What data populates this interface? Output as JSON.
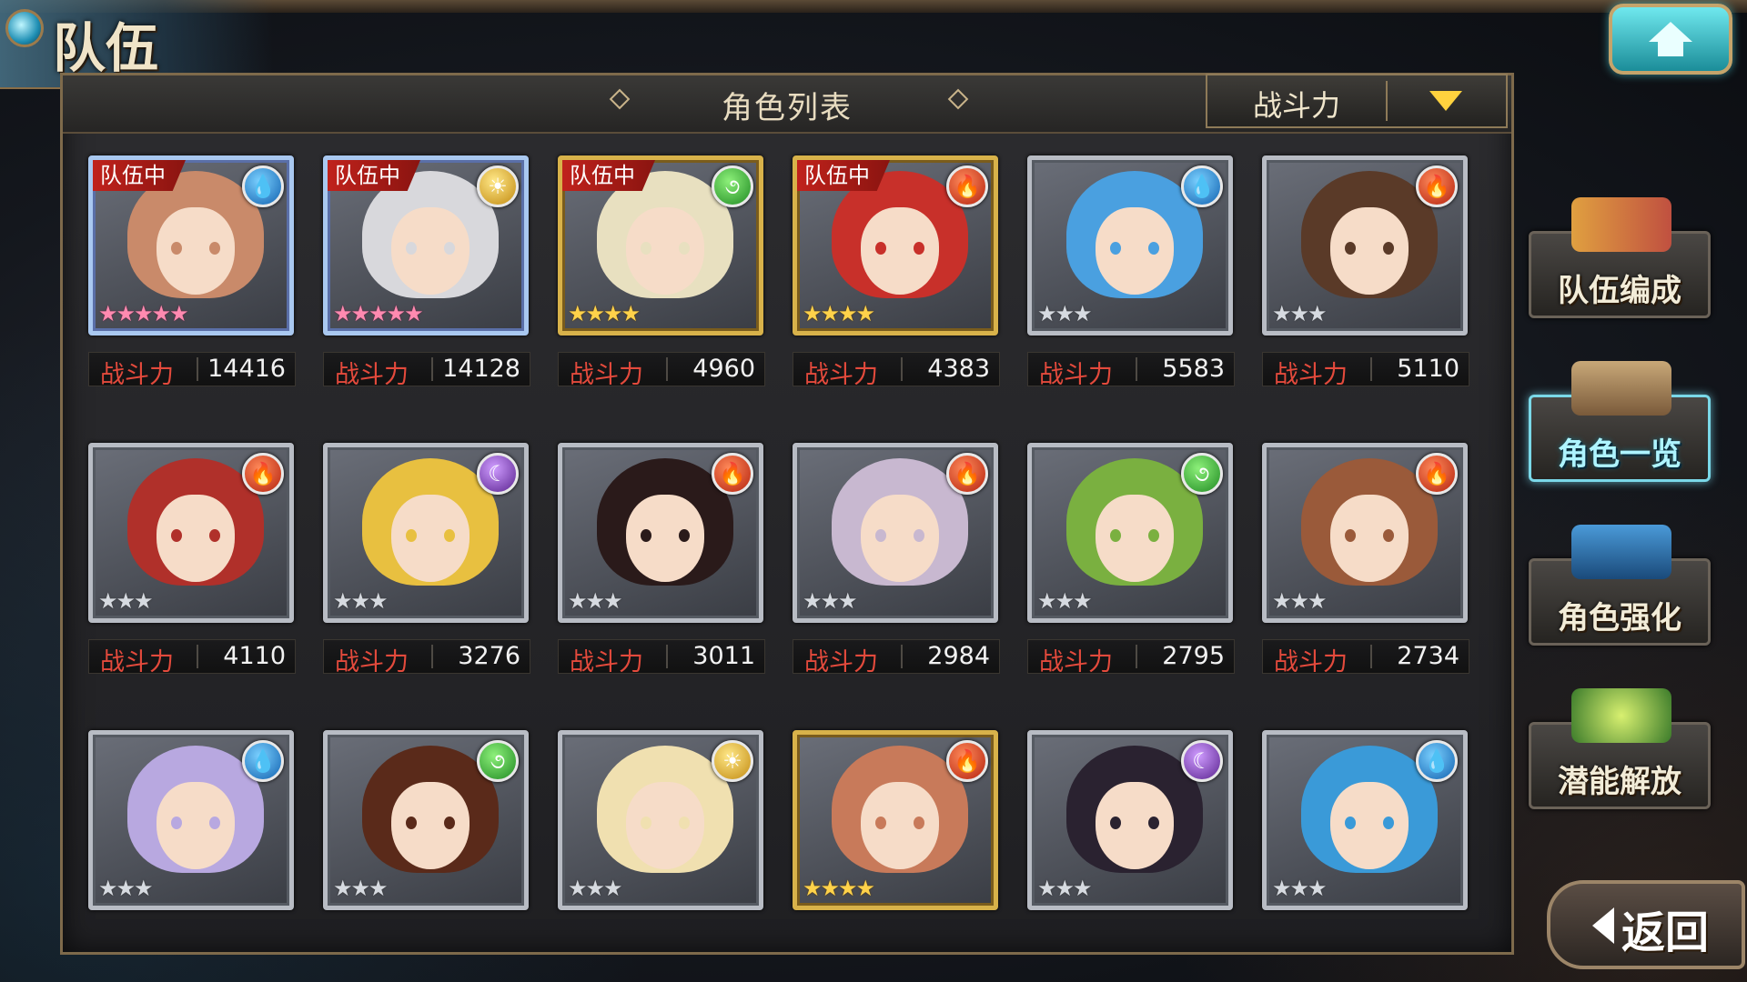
{
  "header": {
    "title": "队伍"
  },
  "panel": {
    "title": "角色列表",
    "sort_label": "战斗力"
  },
  "power_label": "战斗力",
  "side_menu": [
    {
      "label": "队伍编成",
      "active": false
    },
    {
      "label": "角色一览",
      "active": true
    },
    {
      "label": "角色强化",
      "active": false
    },
    {
      "label": "潜能解放",
      "active": false
    }
  ],
  "back_label": "返回",
  "colors": {
    "power_label": "#e34a3c",
    "team_badge": "#c0221c",
    "active_tab_glow": "#7ad8e8"
  },
  "cards": [
    {
      "team_badge": "队伍中",
      "element": "water",
      "rarity": 5,
      "frame": "rainbow",
      "power": "14416",
      "hair": "#c98a6a"
    },
    {
      "team_badge": "队伍中",
      "element": "light",
      "rarity": 5,
      "frame": "rainbow",
      "power": "14128",
      "hair": "#d8d8dc"
    },
    {
      "team_badge": "队伍中",
      "element": "wind",
      "rarity": 4,
      "frame": "gold",
      "power": "4960",
      "hair": "#e8e0c0"
    },
    {
      "team_badge": "队伍中",
      "element": "fire",
      "rarity": 4,
      "frame": "gold",
      "power": "4383",
      "hair": "#c8302a"
    },
    {
      "team_badge": "",
      "element": "water",
      "rarity": 3,
      "frame": "silver",
      "power": "5583",
      "hair": "#4aa0e0"
    },
    {
      "team_badge": "",
      "element": "fire",
      "rarity": 3,
      "frame": "silver",
      "power": "5110",
      "hair": "#5a3a28"
    },
    {
      "team_badge": "",
      "element": "fire",
      "rarity": 3,
      "frame": "silver",
      "power": "4110",
      "hair": "#b0302a"
    },
    {
      "team_badge": "",
      "element": "dark",
      "rarity": 3,
      "frame": "silver",
      "power": "3276",
      "hair": "#e8c040"
    },
    {
      "team_badge": "",
      "element": "fire",
      "rarity": 3,
      "frame": "silver",
      "power": "3011",
      "hair": "#2a1a1a"
    },
    {
      "team_badge": "",
      "element": "fire",
      "rarity": 3,
      "frame": "silver",
      "power": "2984",
      "hair": "#c8b8d0"
    },
    {
      "team_badge": "",
      "element": "wind",
      "rarity": 3,
      "frame": "silver",
      "power": "2795",
      "hair": "#7ab040"
    },
    {
      "team_badge": "",
      "element": "fire",
      "rarity": 3,
      "frame": "silver",
      "power": "2734",
      "hair": "#9a5a3a"
    },
    {
      "team_badge": "",
      "element": "water",
      "rarity": 3,
      "frame": "silver",
      "power": "",
      "hair": "#b8a8e0"
    },
    {
      "team_badge": "",
      "element": "wind",
      "rarity": 3,
      "frame": "silver",
      "power": "",
      "hair": "#5a2a1a"
    },
    {
      "team_badge": "",
      "element": "light",
      "rarity": 3,
      "frame": "silver",
      "power": "",
      "hair": "#f0e0b0"
    },
    {
      "team_badge": "",
      "element": "fire",
      "rarity": 4,
      "frame": "gold",
      "power": "",
      "hair": "#c87a5a"
    },
    {
      "team_badge": "",
      "element": "dark",
      "rarity": 3,
      "frame": "silver",
      "power": "",
      "hair": "#2a2230"
    },
    {
      "team_badge": "",
      "element": "water",
      "rarity": 3,
      "frame": "silver",
      "power": "",
      "hair": "#3a9ad8"
    }
  ]
}
